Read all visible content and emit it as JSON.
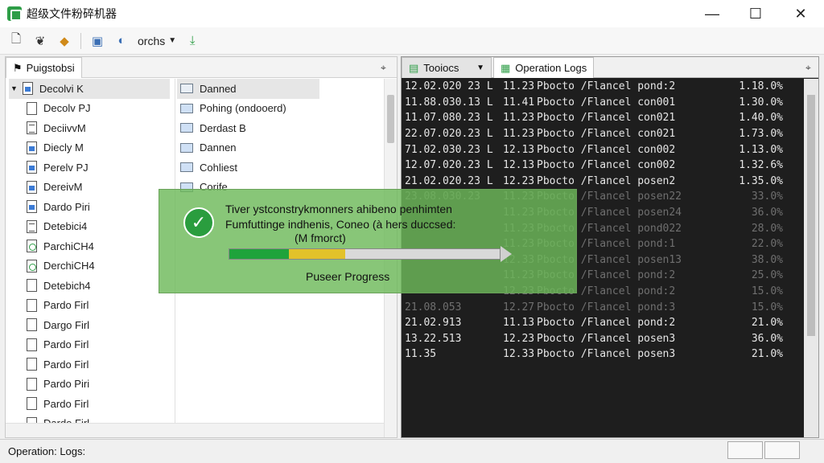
{
  "window": {
    "title": "超级文件粉碎机器",
    "minimize": "—",
    "maximize": "☐",
    "close": "✕"
  },
  "toolbar": {
    "combo_label": "orchs"
  },
  "left_panel": {
    "tab_label": "Puigstobsi",
    "column1": [
      {
        "label": "Decolvi K",
        "icon": "file-blue"
      },
      {
        "label": "Decolv PJ",
        "icon": "file"
      },
      {
        "label": "DeciivvM",
        "icon": "file-lines"
      },
      {
        "label": "Diecly M",
        "icon": "file-blue"
      },
      {
        "label": "Perelv PJ",
        "icon": "file-blue"
      },
      {
        "label": "DereivM",
        "icon": "file-blue"
      },
      {
        "label": "Dardo Piri",
        "icon": "file-blue"
      },
      {
        "label": "Detebici4",
        "icon": "file-lines"
      },
      {
        "label": "ParchiCH4",
        "icon": "file-green"
      },
      {
        "label": "DerchiCH4",
        "icon": "file-green"
      },
      {
        "label": "Detebich4",
        "icon": "file"
      },
      {
        "label": "Pardo Firl",
        "icon": "file"
      },
      {
        "label": "Dargo Firl",
        "icon": "file"
      },
      {
        "label": "Pardo Firl",
        "icon": "file"
      },
      {
        "label": "Pardo Firl",
        "icon": "file"
      },
      {
        "label": "Pardo Piri",
        "icon": "file"
      },
      {
        "label": "Pardo Firl",
        "icon": "file"
      },
      {
        "label": "Dardo Firl",
        "icon": "file"
      }
    ],
    "column2": [
      {
        "label": "Danned",
        "icon": "folder"
      },
      {
        "label": "Pohing (ondooerd)",
        "icon": "folder-blue"
      },
      {
        "label": "Derdast B",
        "icon": "folder-blue"
      },
      {
        "label": "Dannen",
        "icon": "folder-blue"
      },
      {
        "label": "Cohliest",
        "icon": "folder-blue"
      },
      {
        "label": "Corife",
        "icon": "folder-blue"
      }
    ]
  },
  "right_panel": {
    "tab1": "Tooiocs",
    "tab2": "Operation Logs",
    "rows": [
      {
        "date": "12.02.020 23",
        "flag": "L",
        "time": "11.23",
        "op": "Pbocto /Flancel pond:2",
        "pct": "1.18.0%"
      },
      {
        "date": "11.88.030.13",
        "flag": "L",
        "time": "11.41",
        "op": "Pbocto /Flancel con001",
        "pct": "1.30.0%"
      },
      {
        "date": "11.07.080.23",
        "flag": "L",
        "time": "11.23",
        "op": "Pbocto /Flancel con021",
        "pct": "1.40.0%"
      },
      {
        "date": "22.07.020.23",
        "flag": "L",
        "time": "11.23",
        "op": "Pbocto /Flancel con021",
        "pct": "1.73.0%"
      },
      {
        "date": "71.02.030.23",
        "flag": "L",
        "time": "12.13",
        "op": "Pbocto /Flancel con002",
        "pct": "1.13.0%"
      },
      {
        "date": "12.07.020.23",
        "flag": "L",
        "time": "12.13",
        "op": "Pbocto /Flancel con002",
        "pct": "1.32.6%"
      },
      {
        "date": "21.02.020.23",
        "flag": "L",
        "time": "12.23",
        "op": "Pbocto /Flancel posen2",
        "pct": "1.35.0%"
      },
      {
        "date": "23.08.030.23",
        "flag": "",
        "time": "11.23",
        "op": "Pbocto /Flancel posen22",
        "pct": "33.0%"
      },
      {
        "date": "",
        "flag": "",
        "time": "11.23",
        "op": "Pbocto /Flancel posen24",
        "pct": "36.0%"
      },
      {
        "date": "",
        "flag": "",
        "time": "11.23",
        "op": "Pbocto /Flancel pond022",
        "pct": "28.0%"
      },
      {
        "date": "",
        "flag": "",
        "time": "11.23",
        "op": "Pbocto /Flancel pond:1",
        "pct": "22.0%"
      },
      {
        "date": "",
        "flag": "",
        "time": "12.33",
        "op": "Pbocto /Flancel posen13",
        "pct": "38.0%"
      },
      {
        "date": "",
        "flag": "",
        "time": "11.23",
        "op": "Pbocto /Flancel pond:2",
        "pct": "25.0%"
      },
      {
        "date": "",
        "flag": "",
        "time": "12.23",
        "op": "Pbocto /Flancel pond:2",
        "pct": "15.0%"
      },
      {
        "date": "21.08.053",
        "flag": "",
        "time": "12.27",
        "op": "Pbocto /Flancel pond:3",
        "pct": "15.0%"
      },
      {
        "date": "21.02.913",
        "flag": "",
        "time": "11.13",
        "op": "Pbocto /Flancel pond:2",
        "pct": "21.0%"
      },
      {
        "date": "13.22.513",
        "flag": "",
        "time": "12.23",
        "op": "Pbocto /Flancel posen3",
        "pct": "36.0%"
      },
      {
        "date": "11.35",
        "flag": "",
        "time": "12.33",
        "op": "Pbocto /Flancel posen3",
        "pct": "21.0%"
      }
    ]
  },
  "overlay": {
    "line1": "Tiver ystconstrykmonners ahibeno penhimten",
    "line2": "Fumfuttinge indhenis, Coneo (à hers duccsed:",
    "line3": "(M fmorct)",
    "progress_label": "Puseer Progress",
    "progress_green": 0.22,
    "progress_yellow": 0.21
  },
  "status": {
    "text": "Operation: Logs:"
  }
}
